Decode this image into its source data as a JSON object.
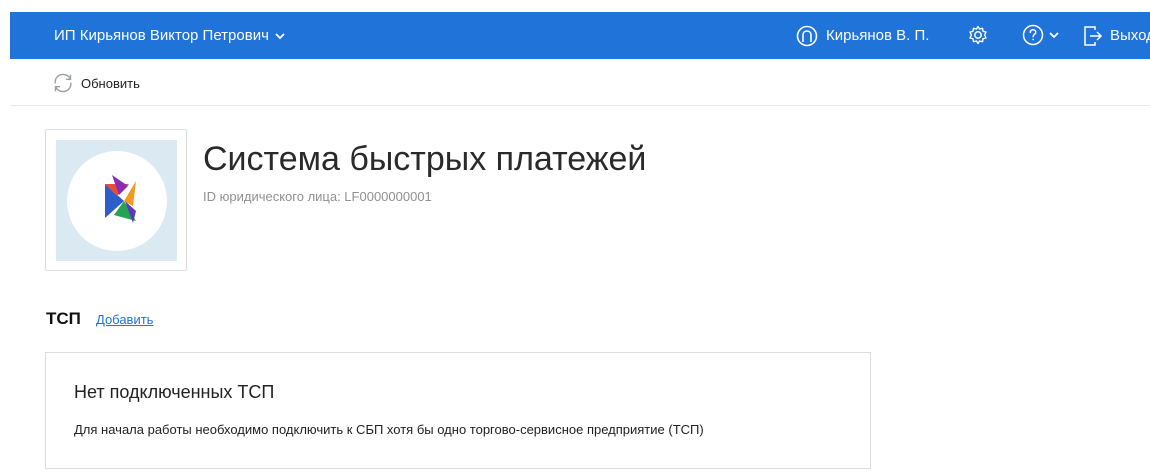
{
  "header": {
    "organization": "ИП Кирьянов Виктор Петрович",
    "user": "Кирьянов В. П.",
    "logout": "Выход",
    "icons": [
      "user-circle-icon",
      "gear-icon",
      "help-icon",
      "chevron-down-icon",
      "logout-icon"
    ],
    "color": "#1f73d9"
  },
  "toolbar": {
    "refresh": "Обновить",
    "icon": "refresh-icon"
  },
  "service": {
    "title": "Система быстрых платежей",
    "legal_id": "ID юридического лица: LF0000000001",
    "logo": "sbp-logo"
  },
  "tsp": {
    "section_title": "ТСП",
    "add": "Добавить",
    "empty_title": "Нет подключенных ТСП",
    "empty_description": "Для начала работы необходимо подключить к СБП хотя бы одно торгово-сервисное предприятие (ТСП)"
  }
}
